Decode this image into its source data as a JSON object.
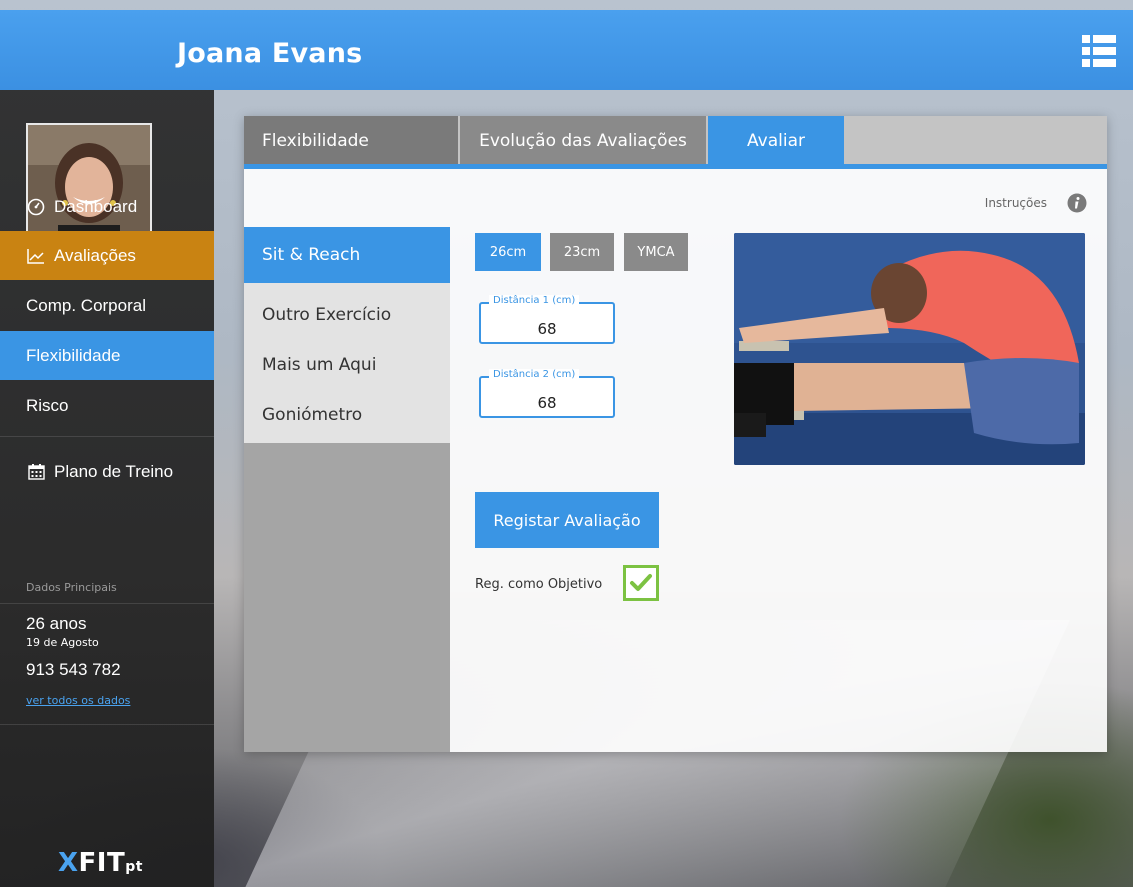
{
  "user": {
    "name": "Joana Evans"
  },
  "sidebar": {
    "items": [
      {
        "label": "Dashboard",
        "icon": "dashboard-icon"
      },
      {
        "label": "Avaliações",
        "icon": "chart-line-icon"
      },
      {
        "label": "Comp. Corporal"
      },
      {
        "label": "Flexibilidade"
      },
      {
        "label": "Risco"
      },
      {
        "label": "Plano de Treino",
        "icon": "calendar-icon"
      }
    ],
    "summary": {
      "title": "Dados Principais",
      "age": "26 anos",
      "birthday": "19 de Agosto",
      "phone": "913 543 782",
      "link": "ver todos os dados"
    },
    "logo": {
      "x": "X",
      "fit": "FIT",
      "pt": "pt"
    }
  },
  "tabs": [
    {
      "label": "Flexibilidade"
    },
    {
      "label": "Evolução das Avaliações"
    },
    {
      "label": "Avaliar"
    }
  ],
  "instructions": "Instruções",
  "subnav": [
    {
      "label": "Sit & Reach"
    },
    {
      "label": "Outro Exercício"
    },
    {
      "label": "Mais um Aqui"
    },
    {
      "label": "Goniómetro"
    }
  ],
  "options": [
    {
      "label": "26cm"
    },
    {
      "label": "23cm"
    },
    {
      "label": "YMCA"
    }
  ],
  "fields": [
    {
      "label": "Distância 1 (cm)",
      "value": "68"
    },
    {
      "label": "Distância 2 (cm)",
      "value": "68"
    }
  ],
  "submit_label": "Registar Avaliação",
  "goal_label": "Reg. como Objetivo",
  "colors": {
    "accent": "#3a95e4",
    "active_orange": "#c98312",
    "check_green": "#7cc242"
  }
}
